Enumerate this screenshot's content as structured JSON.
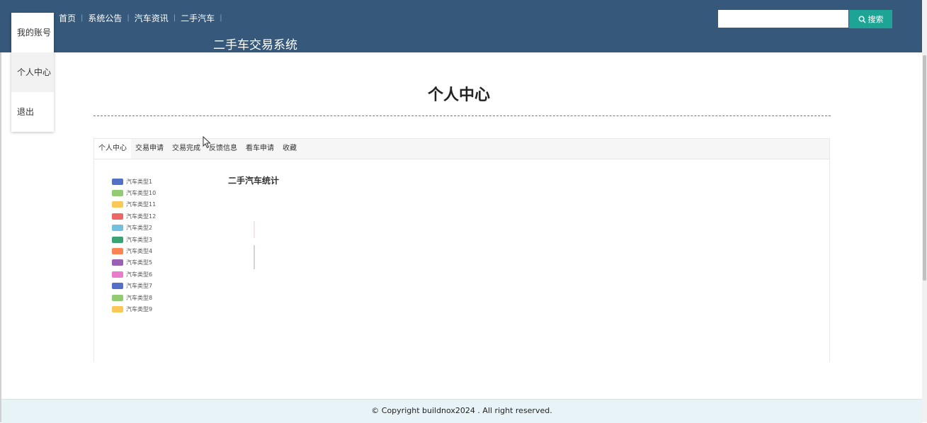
{
  "header": {
    "nav": [
      "首页",
      "系统公告",
      "汽车资讯",
      "二手汽车"
    ],
    "site_title": "二手车交易系统",
    "search": {
      "placeholder": "",
      "button_label": "搜索",
      "icon": "search-icon"
    }
  },
  "user_menu": {
    "items": [
      "我的账号",
      "个人中心",
      "退出"
    ],
    "active": "个人中心"
  },
  "page": {
    "title": "个人中心",
    "tabs": [
      "个人中心",
      "交易申请",
      "交易完成",
      "反馈信息",
      "看车申请",
      "收藏"
    ],
    "active_tab": "个人中心"
  },
  "chart": {
    "title": "二手汽车统计",
    "legend": [
      {
        "name": "汽车类型1",
        "color": "#5470c6"
      },
      {
        "name": "汽车类型10",
        "color": "#91cc75"
      },
      {
        "name": "汽车类型11",
        "color": "#fac858"
      },
      {
        "name": "汽车类型12",
        "color": "#ee6666"
      },
      {
        "name": "汽车类型2",
        "color": "#73c0de"
      },
      {
        "name": "汽车类型3",
        "color": "#3ba272"
      },
      {
        "name": "汽车类型4",
        "color": "#fc8452"
      },
      {
        "name": "汽车类型5",
        "color": "#9a60b4"
      },
      {
        "name": "汽车类型6",
        "color": "#ea7ccc"
      },
      {
        "name": "汽车类型7",
        "color": "#5470c6"
      },
      {
        "name": "汽车类型8",
        "color": "#91cc75"
      },
      {
        "name": "汽车类型9",
        "color": "#fac858"
      }
    ]
  },
  "footer": {
    "copyright": "© Copyright buildnox2024 . All right reserved."
  },
  "colors": {
    "header_bg": "#36587a",
    "accent": "#1ea495",
    "footer_bg": "#e8f3f8"
  }
}
